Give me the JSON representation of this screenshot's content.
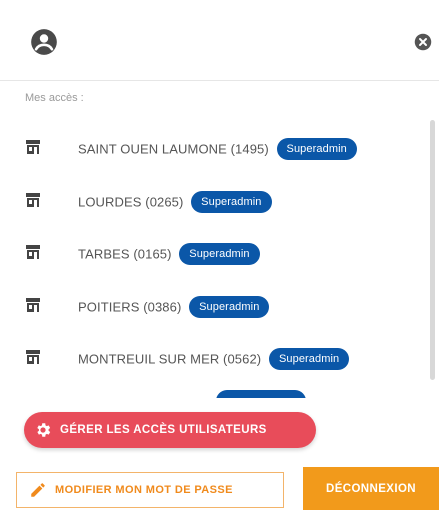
{
  "header": {
    "user_icon": "account-circle-icon",
    "close_icon": "close-circle-icon"
  },
  "access_section": {
    "label": "Mes accès :"
  },
  "access_list": [
    {
      "name": "SAINT OUEN LAUMONE (1495)",
      "role": "Superadmin",
      "icon": "store-icon"
    },
    {
      "name": "LOURDES (0265)",
      "role": "Superadmin",
      "icon": "store-icon"
    },
    {
      "name": "TARBES (0165)",
      "role": "Superadmin",
      "icon": "store-icon"
    },
    {
      "name": "POITIERS (0386)",
      "role": "Superadmin",
      "icon": "store-icon"
    },
    {
      "name": "MONTREUIL SUR MER (0562)",
      "role": "Superadmin",
      "icon": "store-icon"
    },
    {
      "name": "",
      "role": "",
      "icon": "store-icon"
    }
  ],
  "actions": {
    "manage_label": "GÉRER LES ACCÈS UTILISATEURS",
    "manage_icon": "gear-icon",
    "password_label": "MODIFIER MON MOT DE PASSE",
    "password_icon": "pencil-icon",
    "logout_label": "DÉCONNEXION"
  },
  "colors": {
    "badge": "#0b57a8",
    "manage_button": "#e84c5a",
    "password_text": "#f08a1c",
    "logout_button": "#f29a1b"
  }
}
